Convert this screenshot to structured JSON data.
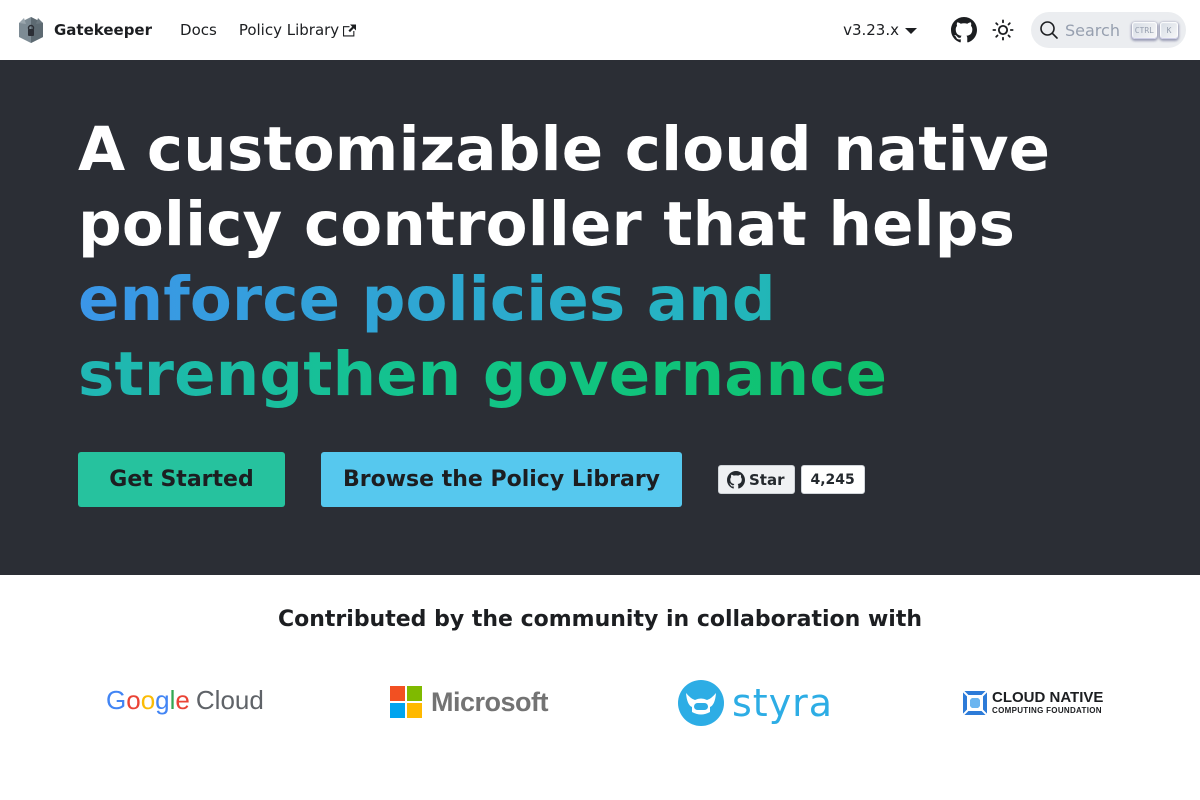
{
  "nav": {
    "brand": "Gatekeeper",
    "links": [
      {
        "label": "Docs"
      },
      {
        "label": "Policy Library",
        "external": true
      }
    ],
    "version": "v3.23.x",
    "github_icon": "github-icon",
    "theme_icon": "sun-icon",
    "search": {
      "placeholder": "Search",
      "keys": [
        "CTRL",
        "K"
      ]
    }
  },
  "hero": {
    "title_plain": "A customizable cloud native policy controller that helps ",
    "title_highlight": "enforce policies and strengthen governance",
    "primary_button": "Get Started",
    "secondary_button": "Browse the Policy Library",
    "github_star": {
      "label": "Star",
      "count": "4,245"
    }
  },
  "partners": {
    "heading": "Contributed by the community in collaboration with",
    "logos": [
      {
        "name": "Google",
        "suffix": "Cloud"
      },
      {
        "name": "Microsoft"
      },
      {
        "name": "styra"
      },
      {
        "name": "CLOUD NATIVE",
        "subline": "COMPUTING FOUNDATION"
      }
    ]
  },
  "colors": {
    "hero_bg": "#2b2e35",
    "primary": "#26c29e",
    "secondary": "#56c8ee",
    "gradient_start": "#3b96e8",
    "gradient_end": "#0fc26c"
  }
}
